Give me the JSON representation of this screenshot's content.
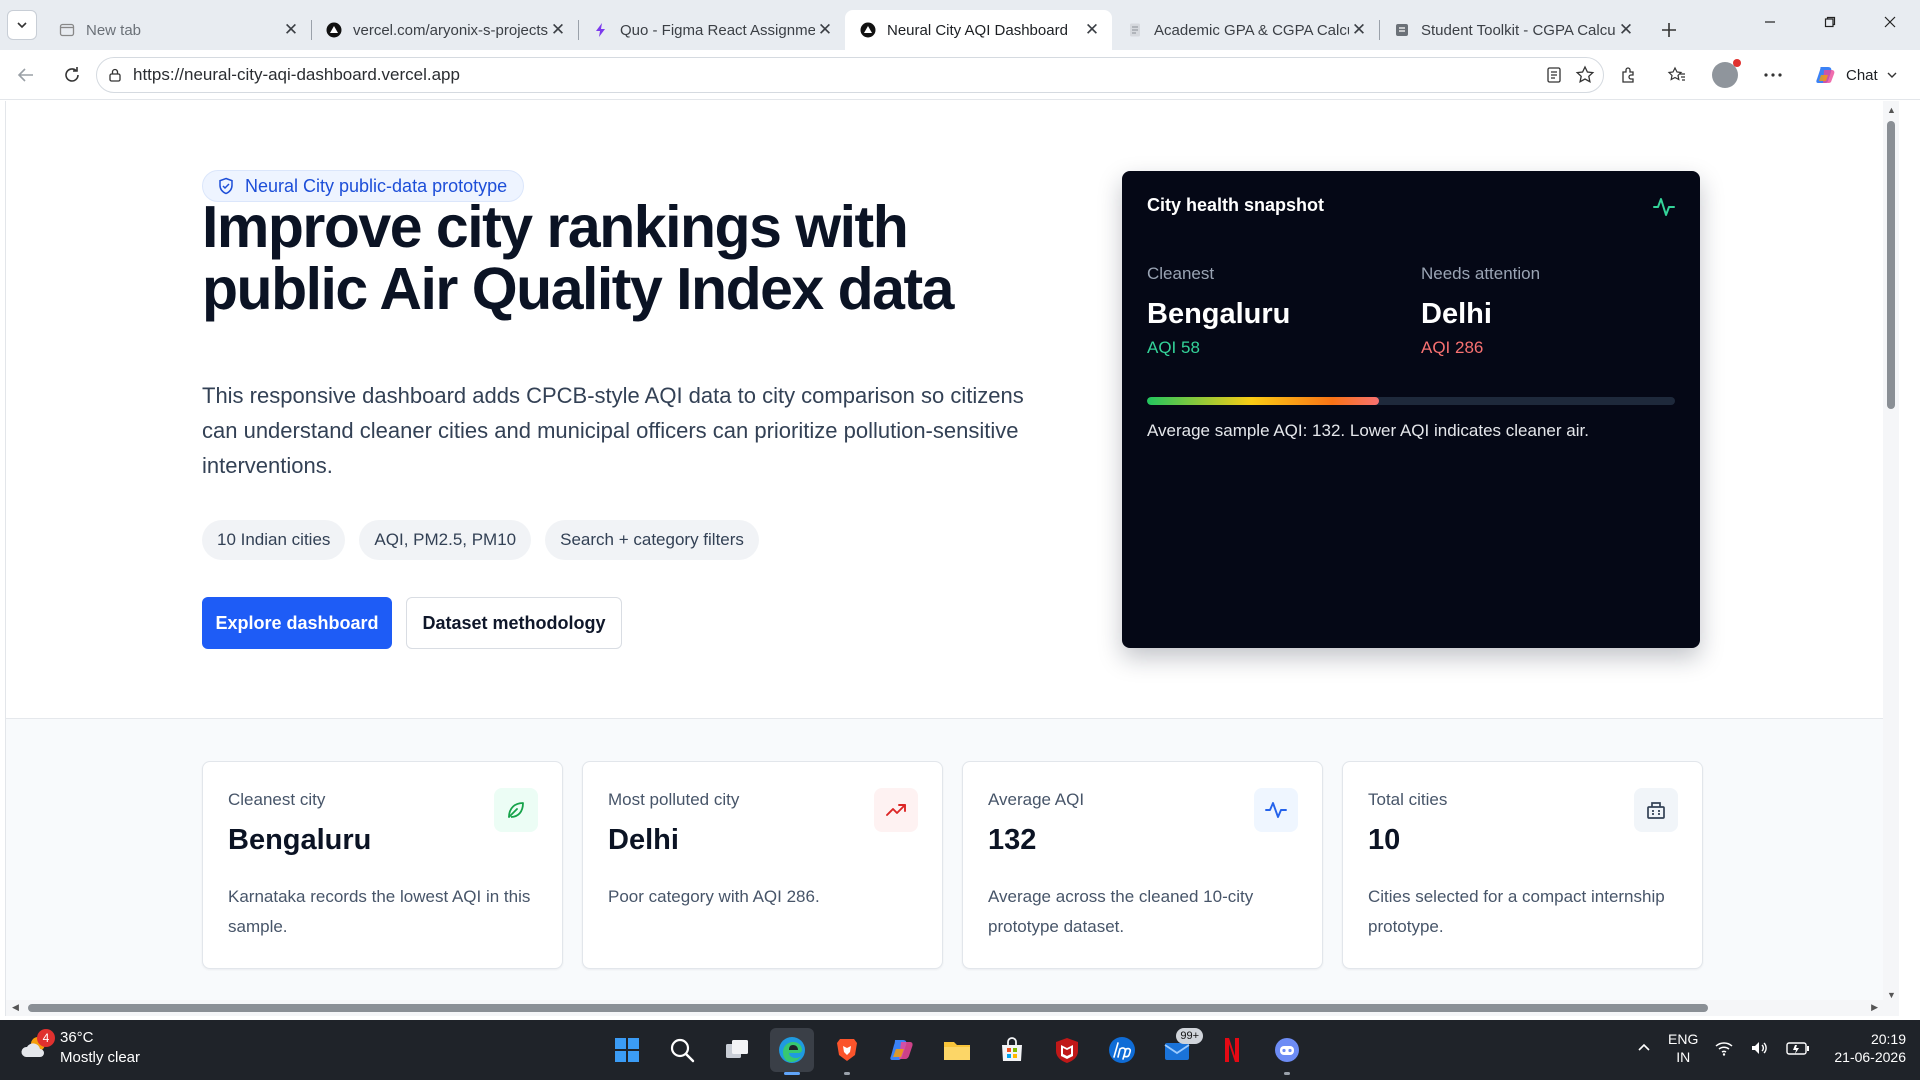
{
  "browser": {
    "tabs": [
      {
        "title": "New tab",
        "active": false
      },
      {
        "title": "vercel.com/aryonix-s-projects",
        "active": false
      },
      {
        "title": "Quo - Figma React Assignment",
        "active": false
      },
      {
        "title": "Neural City AQI Dashboard",
        "active": true
      },
      {
        "title": "Academic GPA & CGPA Calculator",
        "active": false
      },
      {
        "title": "Student Toolkit - CGPA Calculator",
        "active": false
      }
    ],
    "url": "https://neural-city-aqi-dashboard.vercel.app",
    "chat_label": "Chat"
  },
  "hero": {
    "badge": "Neural City public-data prototype",
    "title": "Improve city rankings with public Air Quality Index data",
    "subtitle": "This responsive dashboard adds CPCB-style AQI data to city comparison so citizens can understand cleaner cities and municipal officers can prioritize pollution-sensitive interventions.",
    "chips": [
      "10 Indian cities",
      "AQI, PM2.5, PM10",
      "Search + category filters"
    ],
    "primary_button": "Explore dashboard",
    "secondary_button": "Dataset methodology"
  },
  "snapshot": {
    "title": "City health snapshot",
    "cleanest_label": "Cleanest",
    "cleanest_city": "Bengaluru",
    "cleanest_aqi": "AQI 58",
    "attention_label": "Needs attention",
    "attention_city": "Delhi",
    "attention_aqi": "AQI 286",
    "bar_fill_fraction": 0.44,
    "note": "Average sample AQI: 132. Lower AQI indicates cleaner air."
  },
  "stats": [
    {
      "label": "Cleanest city",
      "value": "Bengaluru",
      "desc": "Karnataka records the lowest AQI in this sample.",
      "icon": "leaf-icon"
    },
    {
      "label": "Most polluted city",
      "value": "Delhi",
      "desc": "Poor category with AQI 286.",
      "icon": "trending-up-icon"
    },
    {
      "label": "Average AQI",
      "value": "132",
      "desc": "Average across the cleaned 10-city prototype dataset.",
      "icon": "activity-icon"
    },
    {
      "label": "Total cities",
      "value": "10",
      "desc": "Cities selected for a compact internship prototype.",
      "icon": "building-icon"
    }
  ],
  "colors": {
    "primary": "#1e5cf6",
    "snapshot_bg": "#050816",
    "good": "#34d399",
    "bad": "#f87171"
  },
  "taskbar": {
    "weather_badge": "4",
    "temperature": "36°C",
    "condition": "Mostly clear",
    "store_badge": "99+",
    "lang_line1": "ENG",
    "lang_line2": "IN",
    "time": "20:19",
    "date": "21-06-2026"
  }
}
